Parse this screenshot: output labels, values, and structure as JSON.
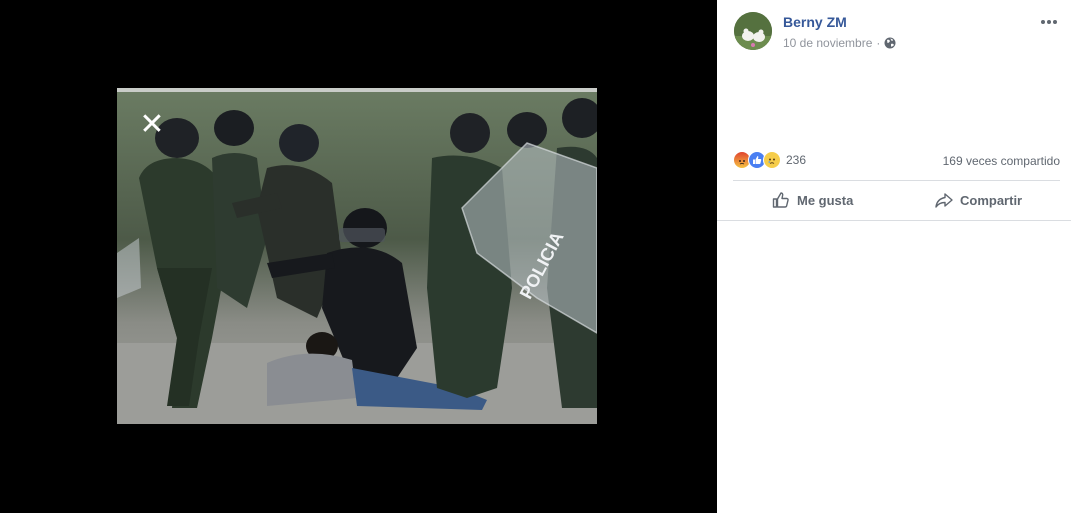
{
  "viewer": {
    "close_glyph": "✕",
    "photo_text": "POLICIA"
  },
  "post": {
    "author": "Berny ZM",
    "date": "10 de noviembre",
    "separator": "·",
    "privacy_icon": "globe-icon",
    "more_icon": "more-options-icon"
  },
  "engagement": {
    "reaction_icons": [
      "angry-icon",
      "like-icon",
      "sad-icon"
    ],
    "reaction_count": "236",
    "shares": "169 veces compartido"
  },
  "actions": {
    "like_label": "Me gusta",
    "share_label": "Compartir"
  },
  "colors": {
    "author_link": "#365899",
    "meta_gray": "#90949c",
    "action_gray": "#606770"
  }
}
